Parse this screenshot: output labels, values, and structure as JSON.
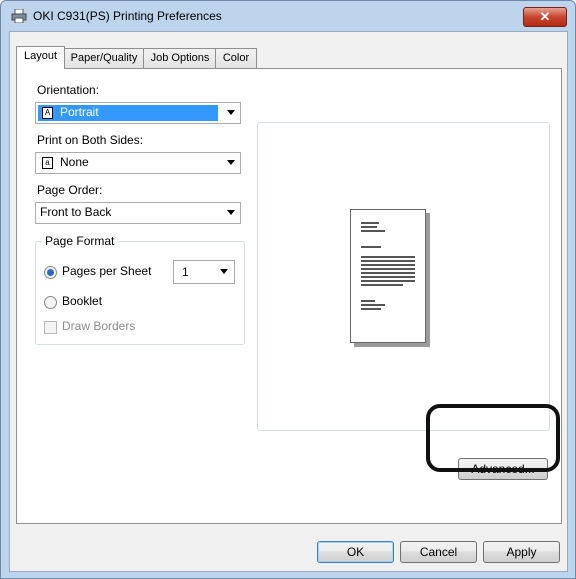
{
  "window": {
    "title": "OKI C931(PS) Printing Preferences",
    "close_glyph": "✕"
  },
  "tabs": [
    {
      "label": "Layout",
      "active": true
    },
    {
      "label": "Paper/Quality",
      "active": false
    },
    {
      "label": "Job Options",
      "active": false
    },
    {
      "label": "Color",
      "active": false
    }
  ],
  "layout": {
    "orientation_label": "Orientation:",
    "orientation_value": "Portrait",
    "orientation_icon_glyph": "A",
    "both_sides_label": "Print on Both Sides:",
    "both_sides_value": "None",
    "both_sides_icon_glyph": "a",
    "page_order_label": "Page Order:",
    "page_order_value": "Front to Back",
    "page_format": {
      "title": "Page Format",
      "pages_per_sheet_label": "Pages per Sheet",
      "pages_per_sheet_selected": true,
      "pages_per_sheet_value": "1",
      "booklet_label": "Booklet",
      "booklet_selected": false,
      "draw_borders_label": "Draw Borders",
      "draw_borders_checked": false,
      "draw_borders_enabled": false
    },
    "advanced_button": "Advanced..."
  },
  "footer": {
    "ok": "OK",
    "cancel": "Cancel",
    "apply": "Apply"
  },
  "colors": {
    "selection": "#3399ff",
    "titlebar": "#bcd4ec",
    "close": "#c9452f",
    "callout": "#111111"
  }
}
